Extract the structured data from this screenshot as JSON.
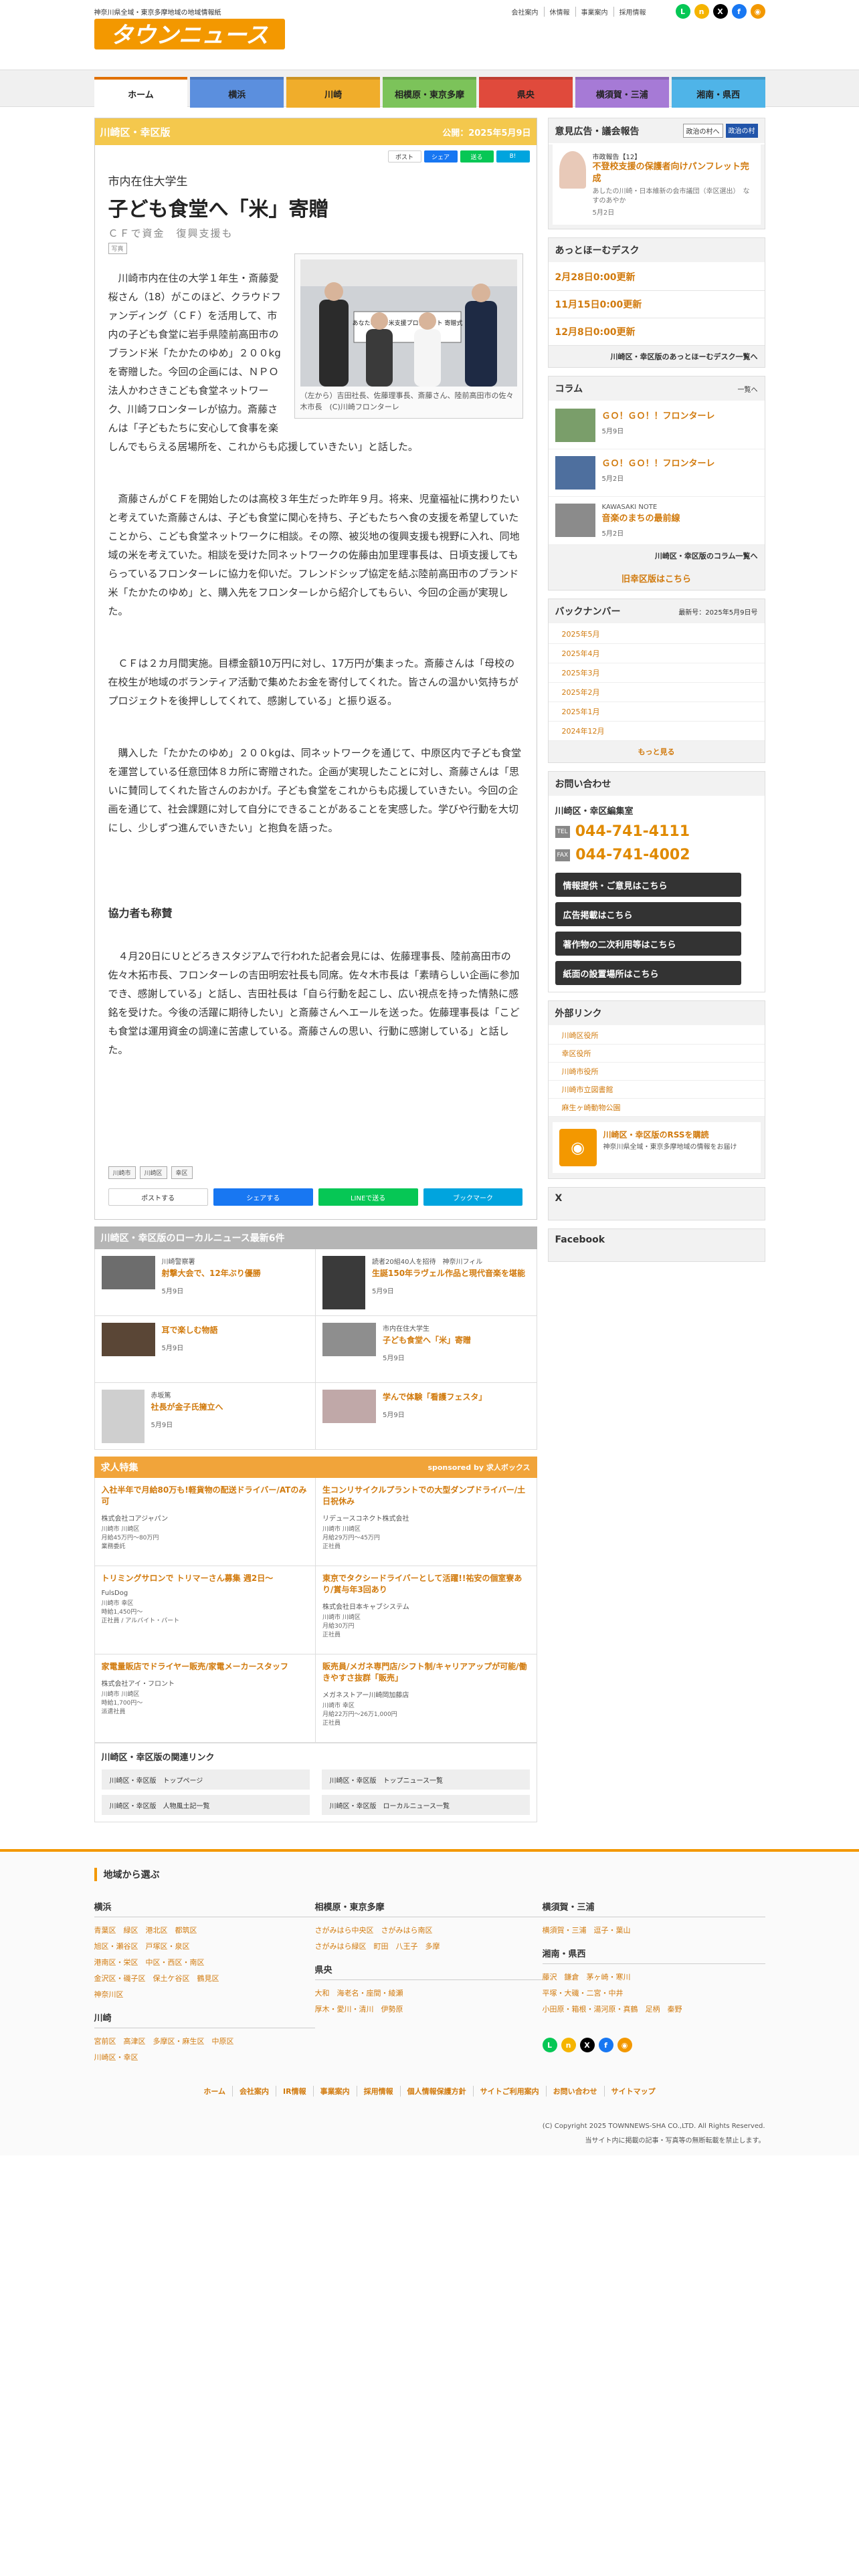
{
  "header": {
    "tagline": "神奈川県全域・東京多摩地域の地域情報紙",
    "logo_text": "タウンニュース",
    "top_links": [
      "会社案内",
      "休情報",
      "事業案内",
      "採用情報"
    ]
  },
  "nav": {
    "tabs": [
      {
        "label": "ホーム",
        "color": "#f0f0f0"
      },
      {
        "label": "横浜",
        "color": "#5b8fde"
      },
      {
        "label": "川崎",
        "color": "#f0ad2b"
      },
      {
        "label": "相模原・東京多摩",
        "color": "#7cc35a"
      },
      {
        "label": "県央",
        "color": "#e04a3c"
      },
      {
        "label": "横須賀・三浦",
        "color": "#a67ad6"
      },
      {
        "label": "湘南・県西",
        "color": "#4fb4e8"
      }
    ]
  },
  "article": {
    "area": "川崎区・幸区版",
    "published": "公開：2025年5月9日",
    "subtitle": "市内在住大学生",
    "title": "子ども食堂へ「米」寄贈",
    "kicker": "ＣＦで資金　復興支援も",
    "badge": "写真",
    "caption": "（左から）吉田社長、佐藤理事長、斎藤さん、陸前高田市の佐々木市長　(C)川崎フロンターレ",
    "photo_banner": "あなたの…お米支援プロジェクト 寄贈式",
    "paragraphs": [
      "川崎市内在住の大学１年生・斎藤愛桜さん（18）がこのほど、クラウドファンディング（ＣＦ）を活用して、市内の子ども食堂に岩手県陸前高田市のブランド米「たかたのゆめ」２００kgを寄贈した。今回の企画には、ＮＰＯ法人かわさきこども食堂ネットワーク、川崎フロンターレが協力。斎藤さんは「子どもたちに安心して食事を楽しんでもらえる居場所を、これからも応援していきたい」と話した。",
      "斎藤さんがＣＦを開始したのは高校３年生だった昨年９月。将来、児童福祉に携わりたいと考えていた斎藤さんは、子ども食堂に関心を持ち、子どもたちへ食の支援を希望していたことから、こども食堂ネットワークに相談。その際、被災地の復興支援も視野に入れ、同地域の米を考えていた。相談を受けた同ネットワークの佐藤由加里理事長は、日頃支援してもらっているフロンターレに協力を仰いだ。フレンドシップ協定を結ぶ陸前高田市のブランド米「たかたのゆめ」と、購入先をフロンターレから紹介してもらい、今回の企画が実現した。",
      "ＣＦは２カ月間実施。目標金額10万円に対し、17万円が集まった。斎藤さんは「母校の在校生が地域のボランティア活動で集めたお金を寄付してくれた。皆さんの温かい気持ちがプロジェクトを後押ししてくれて、感謝している」と振り返る。",
      "購入した「たかたのゆめ」２００kgは、同ネットワークを通じて、中原区内で子ども食堂を運営している任意団体８カ所に寄贈された。企画が実現したことに対し、斎藤さんは「思いに賛同してくれた皆さんのおかげ。子ども食堂をこれからも応援していきたい。今回の企画を通じて、社会課題に対して自分にできることがあることを実感した。学びや行動を大切にし、少しずつ進んでいきたい」と抱負を語った。"
    ],
    "subhead": "協力者も称賛",
    "paragraphs2": [
      "４月20日にＵとどろきスタジアムで行われた記者会見には、佐藤理事長、陸前高田市の佐々木拓市長、フロンターレの吉田明宏社長も同席。佐々木市長は「素晴らしい企画に参加でき、感謝している」と話し、吉田社長は「自ら行動を起こし、広い視点を持った情熱に感銘を受けた。今後の活躍に期待したい」と斎藤さんへエールを送った。佐藤理事長は「こども食堂は運用資金の調達に苦慮している。斎藤さんの思い、行動に感謝している」と話した。"
    ],
    "tags": [
      "川崎市",
      "川崎区",
      "幸区"
    ],
    "share": {
      "x": "ポストする",
      "fb": "シェアする",
      "line": "LINEで送る",
      "hatena": "ブックマーク"
    },
    "share_top": {
      "x": "ポスト",
      "fb": "シェア",
      "line": "送る",
      "hatena": "B!"
    }
  },
  "local_news": {
    "header": "川崎区・幸区版のローカルニュース最新6件",
    "items": [
      {
        "kicker": "川崎警察署",
        "title": "射撃大会で、12年ぶり優勝",
        "date": "5月9日"
      },
      {
        "kicker": "読者20組40人を招待　神奈川フィル",
        "title": "生誕150年ラヴェル作品と現代音楽を堪能",
        "date": "5月9日"
      },
      {
        "kicker": "",
        "title": "耳で楽しむ物語",
        "date": "5月9日"
      },
      {
        "kicker": "市内在住大学生",
        "title": "子ども食堂へ「米」寄贈",
        "date": "5月9日"
      },
      {
        "kicker": "赤坂篤",
        "title": "社長が金子氏擁立へ",
        "date": "5月9日"
      },
      {
        "kicker": "",
        "title": "学んで体験「看護フェスタ」",
        "date": "5月9日"
      }
    ]
  },
  "jobs": {
    "header": "求人特集",
    "sponsor": "sponsored by 求人ボックス",
    "items": [
      {
        "title": "入社半年で月給80万も!軽貨物の配送ドライバー/ATのみ可",
        "company": "株式会社コアジャパン",
        "meta": [
          "川崎市 川崎区",
          "月給45万円～80万円",
          "業務委託"
        ]
      },
      {
        "title": "生コンリサイクルプラントでの大型ダンプドライバー/土日祝休み",
        "company": "リデュースコネクト株式会社",
        "meta": [
          "川崎市 川崎区",
          "月給29万円～45万円",
          "正社員"
        ]
      },
      {
        "title": "トリミングサロンで トリマーさん募集 週2日～",
        "company": "FulsDog",
        "meta": [
          "川崎市 幸区",
          "時給1,450円～",
          "正社員 / アルバイト・パート"
        ]
      },
      {
        "title": "東京でタクシードライバーとして活躍!!祐安の個室寮あり/賞与年3回あり",
        "company": "株式会社日本キャブシステム",
        "meta": [
          "川崎市 川崎区",
          "月給30万円",
          "正社員"
        ]
      },
      {
        "title": "家電量販店でドライヤー販売/家電メーカースタッフ",
        "company": "株式会社アイ・フロント",
        "meta": [
          "川崎市 川崎区",
          "時給1,700円～",
          "派遣社員"
        ]
      },
      {
        "title": "販売員/メガネ専門店/シフト制/キャリアアップが可能/働きやすさ抜群「販売」",
        "company": "メガネストアー川崎岡加藤店",
        "meta": [
          "川崎市 幸区",
          "月給22万円～26万1,000円",
          "正社員"
        ]
      }
    ]
  },
  "related": {
    "header": "川崎区・幸区版の関連リンク",
    "links": [
      "川崎区・幸区版　トップページ",
      "川崎区・幸区版　トップニュース一覧",
      "川崎区・幸区版　人物風土記一覧",
      "川崎区・幸区版　ローカルニュース一覧"
    ]
  },
  "sidebar": {
    "opinion": {
      "header": "意見広告・議会報告",
      "btn": "政治の村へ",
      "logo": "政治の村",
      "kicker": "市政報告【12】",
      "title": "不登校支援の保護者向けパンフレット完成",
      "sub": "あしたの川崎・日本維新の会市議団（幸区選出）　なすのあやか",
      "date": "5月2日"
    },
    "desk": {
      "header": "あっとほーむデスク",
      "items": [
        "2月28日0:00更新",
        "11月15日0:00更新",
        "12月8日0:00更新"
      ],
      "more": "川崎区・幸区版のあっとほーむデスク一覧へ"
    },
    "column": {
      "header": "コラム",
      "more_btn": "一覧へ",
      "items": [
        {
          "kicker": "",
          "title": "ＧＯ！ＧＯ！！フロンターレ",
          "date": "5月9日"
        },
        {
          "kicker": "",
          "title": "ＧＯ！ＧＯ！！フロンターレ",
          "date": "5月2日"
        },
        {
          "kicker": "KAWASAKI NOTE",
          "title": "音楽のまちの最前線",
          "date": "5月2日"
        }
      ],
      "more": "川崎区・幸区版のコラム一覧へ",
      "old": "旧幸区版はこちら"
    },
    "backnumber": {
      "header": "バックナンバー",
      "latest": "最新号：2025年5月9日号",
      "items": [
        "2025年5月",
        "2025年4月",
        "2025年3月",
        "2025年2月",
        "2025年1月",
        "2024年12月"
      ],
      "more": "もっと見る"
    },
    "contact": {
      "header": "お問い合わせ",
      "office": "川崎区・幸区編集室",
      "tel_label": "TEL",
      "tel": "044-741-4111",
      "fax_label": "FAX",
      "fax": "044-741-4002",
      "buttons": [
        "情報提供・ご意見はこちら",
        "広告掲載はこちら",
        "著作物の二次利用等はこちら",
        "紙面の設置場所はこちら"
      ]
    },
    "external": {
      "header": "外部リンク",
      "items": [
        "川崎区役所",
        "幸区役所",
        "川崎市役所",
        "川崎市立図書館",
        "麻生ヶ崎動物公園"
      ]
    },
    "rss": {
      "title": "川崎区・幸区版のRSSを購読",
      "sub": "神奈川県全域・東京多摩地域の情報をお届け"
    },
    "x_header": "X",
    "fb_header": "Facebook"
  },
  "footer": {
    "header": "地域から選ぶ",
    "cols": [
      [
        {
          "h": "横浜",
          "links": [
            "青葉区　緑区　港北区　都筑区",
            "旭区・瀬谷区　戸塚区・泉区",
            "港南区・栄区　中区・西区・南区",
            "金沢区・磯子区　保土ケ谷区　鶴見区",
            "神奈川区"
          ]
        },
        {
          "h": "川崎",
          "links": [
            "宮前区　高津区　多摩区・麻生区　中原区",
            "川崎区・幸区"
          ]
        }
      ],
      [
        {
          "h": "相模原・東京多摩",
          "links": [
            "さがみはら中央区　さがみはら南区",
            "さがみはら緑区　町田　八王子　多摩"
          ]
        },
        {
          "h": "県央",
          "links": [
            "大和　海老名・座間・綾瀬",
            "厚木・愛川・清川　伊勢原"
          ]
        }
      ],
      [
        {
          "h": "横須賀・三浦",
          "links": [
            "横須賀・三浦　逗子・葉山"
          ]
        },
        {
          "h": "湘南・県西",
          "links": [
            "藤沢　鎌倉　茅ヶ崎・寒川",
            "平塚・大磯・二宮・中井",
            "小田原・箱根・湯河原・真鶴　足柄　秦野"
          ]
        }
      ]
    ],
    "nav": [
      "ホーム",
      "会社案内",
      "IR情報",
      "事業案内",
      "採用情報",
      "個人情報保護方針",
      "サイトご利用案内",
      "お問い合わせ",
      "サイトマップ"
    ],
    "copyright": "(C) Copyright 2025 TOWNNEWS-SHA CO.,LTD. All Rights Reserved.",
    "note": "当サイト内に掲載の記事・写真等の無断転載を禁止します。"
  },
  "colors": {
    "accent": "#f39800",
    "link": "#d17a0d",
    "area_header": "#f4c84d"
  }
}
